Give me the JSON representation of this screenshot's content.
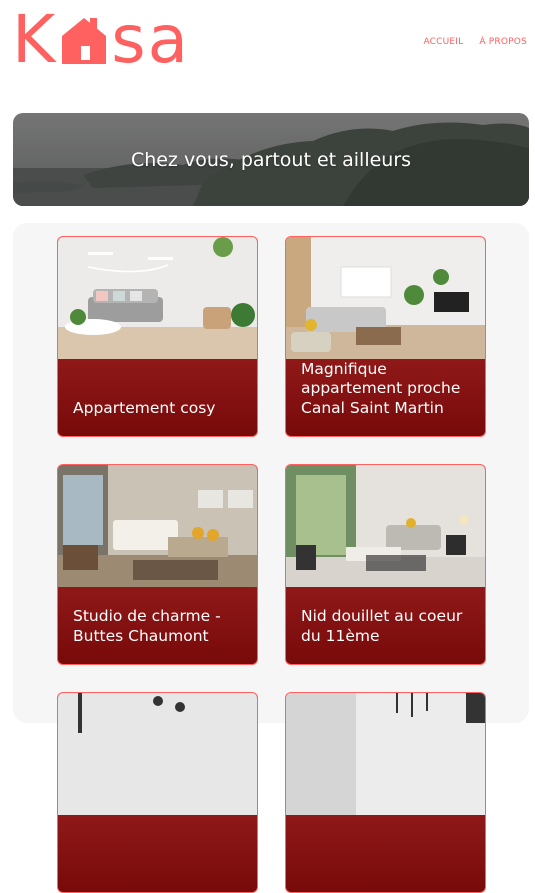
{
  "header": {
    "logo_letters": [
      "K",
      "s",
      "a"
    ],
    "logo_icon": "house-icon",
    "nav": [
      {
        "label": "ACCUEIL"
      },
      {
        "label": "À PROPOS"
      }
    ]
  },
  "banner": {
    "title": "Chez vous, partout et ailleurs"
  },
  "colors": {
    "brand": "#ff6060",
    "card_gradient_top": "#b02a2a",
    "card_gradient_bottom": "#780a0a",
    "gallery_bg": "#f6f6f6"
  },
  "cards": [
    {
      "title": "Appartement cosy"
    },
    {
      "title": "Magnifique appartement proche Canal Saint Martin"
    },
    {
      "title": "Studio de charme - Buttes Chaumont"
    },
    {
      "title": "Nid douillet au coeur du 11ème"
    },
    {
      "title": ""
    },
    {
      "title": ""
    }
  ]
}
